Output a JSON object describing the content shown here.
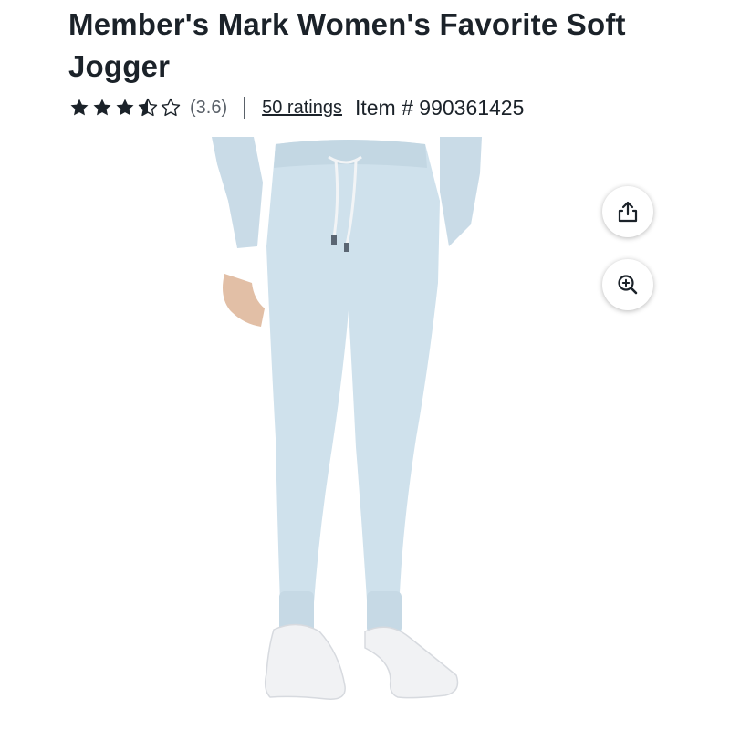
{
  "product": {
    "title": "Member's Mark Women's Favorite Soft Jogger",
    "rating": 3.6,
    "rating_display": "(3.6)",
    "stars_full": 3,
    "stars_half": 1,
    "stars_empty": 1,
    "ratings_count_label": "50 ratings",
    "item_number_label": "Item # 990361425"
  },
  "actions": {
    "share_icon": "share-icon",
    "zoom_icon": "zoom-in-icon"
  },
  "colors": {
    "pants": "#cfe1ec",
    "text": "#1b2229",
    "muted": "#5a6169"
  }
}
